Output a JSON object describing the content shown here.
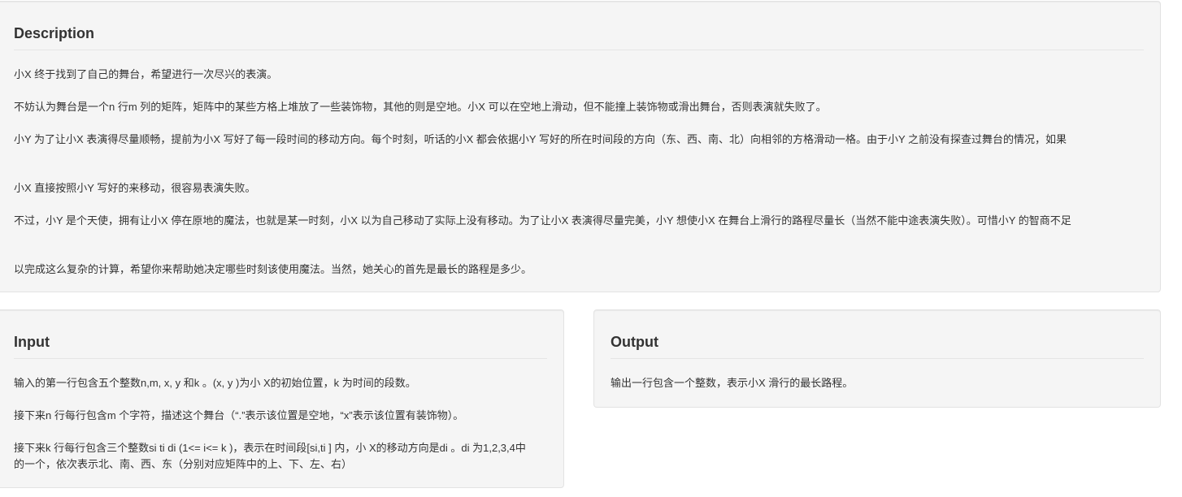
{
  "description": {
    "title": "Description",
    "paragraphs": [
      "小X 终于找到了自己的舞台，希望进行一次尽兴的表演。",
      "不妨认为舞台是一个n 行m 列的矩阵，矩阵中的某些方格上堆放了一些装饰物，其他的则是空地。小X 可以在空地上滑动，但不能撞上装饰物或滑出舞台，否则表演就失败了。",
      "小Y 为了让小X 表演得尽量顺畅，提前为小X 写好了每一段时间的移动方向。每个时刻，听话的小X 都会依据小Y 写好的所在时间段的方向（东、西、南、北）向相邻的方格滑动一格。由于小Y 之前没有探查过舞台的情况，如果",
      "小X 直接按照小Y 写好的来移动，很容易表演失败。",
      "不过，小Y 是个天使，拥有让小X 停在原地的魔法，也就是某一时刻，小X 以为自己移动了实际上没有移动。为了让小X 表演得尽量完美，小Y 想使小X 在舞台上滑行的路程尽量长（当然不能中途表演失败）。可惜小Y 的智商不足",
      "以完成这么复杂的计算，希望你来帮助她决定哪些时刻该使用魔法。当然，她关心的首先是最长的路程是多少。"
    ]
  },
  "input": {
    "title": "Input",
    "paragraphs": [
      "输入的第一行包含五个整数n,m, x, y 和k 。(x, y )为小 X的初始位置，k 为时间的段数。",
      "接下来n 行每行包含m 个字符，描述这个舞台（“.”表示该位置是空地，“x”表示该位置有装饰物）。",
      "接下来k 行每行包含三个整数si ti di (1<= i<= k )，表示在时间段[si,ti ] 内，小 X的移动方向是di 。di 为1,2,3,4中的一个，依次表示北、南、西、东（分别对应矩阵中的上、下、左、右）"
    ]
  },
  "output": {
    "title": "Output",
    "paragraphs": [
      "输出一行包含一个整数，表示小X 滑行的最长路程。"
    ]
  }
}
